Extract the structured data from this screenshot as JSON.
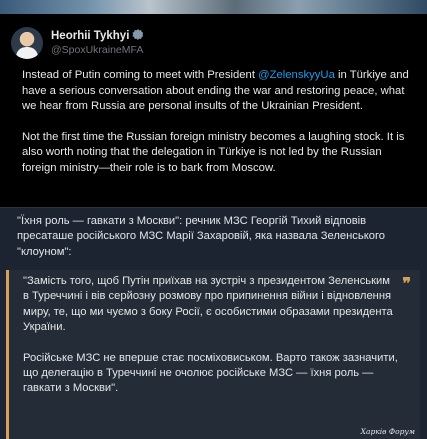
{
  "tweet": {
    "author_name": "Heorhii Tykhyi",
    "author_handle": "@SpoxUkraineMFA",
    "paragraph1_before": "Instead of Putin coming to meet with President ",
    "paragraph1_mention": "@ZelenskyyUa",
    "paragraph1_after": " in Türkiye and have a serious conversation about ending the war and restoring peace, what we hear from Russia are personal insults of the Ukrainian President.",
    "paragraph2": "Not the first time the Russian foreign ministry becomes a laughing stock. It is also worth noting that the delegation in Türkiye is not led by the Russian foreign ministry—their role is to bark from Moscow."
  },
  "article": {
    "lead": "\"Їхня роль — гавкати з Москви\": речник МЗС Георгій Тихий відповів пресаташе російського МЗС Марії Захаровій, яка назвала Зеленського \"клоуном\":",
    "quote_line1": "\"Замість того, щоб Путін приїхав на зустріч з президентом Зеленським",
    "quote_line2": "в Туреччині і вів серйозну розмову про припинення війни і відновлення миру, те, що ми чуємо з боку Росії, є особистими образами президента України.",
    "quote_paragraph2": "Російське МЗС не вперше стає посміховиськом. Варто також зазначити, що делегацію в Туреччині не очолює російське МЗС — їхня роль — гавкати з Москви\".",
    "quote_mark": "❞"
  },
  "watermark": "Харків Форум",
  "colors": {
    "background": "#1b2430",
    "tweet_background": "#000000",
    "mention": "#1d9bf0",
    "quote_accent": "#d6a05a",
    "quote_background": "#232c37"
  },
  "icons": {
    "verified": "verified-badge-icon",
    "quote": "quote-mark-icon"
  }
}
